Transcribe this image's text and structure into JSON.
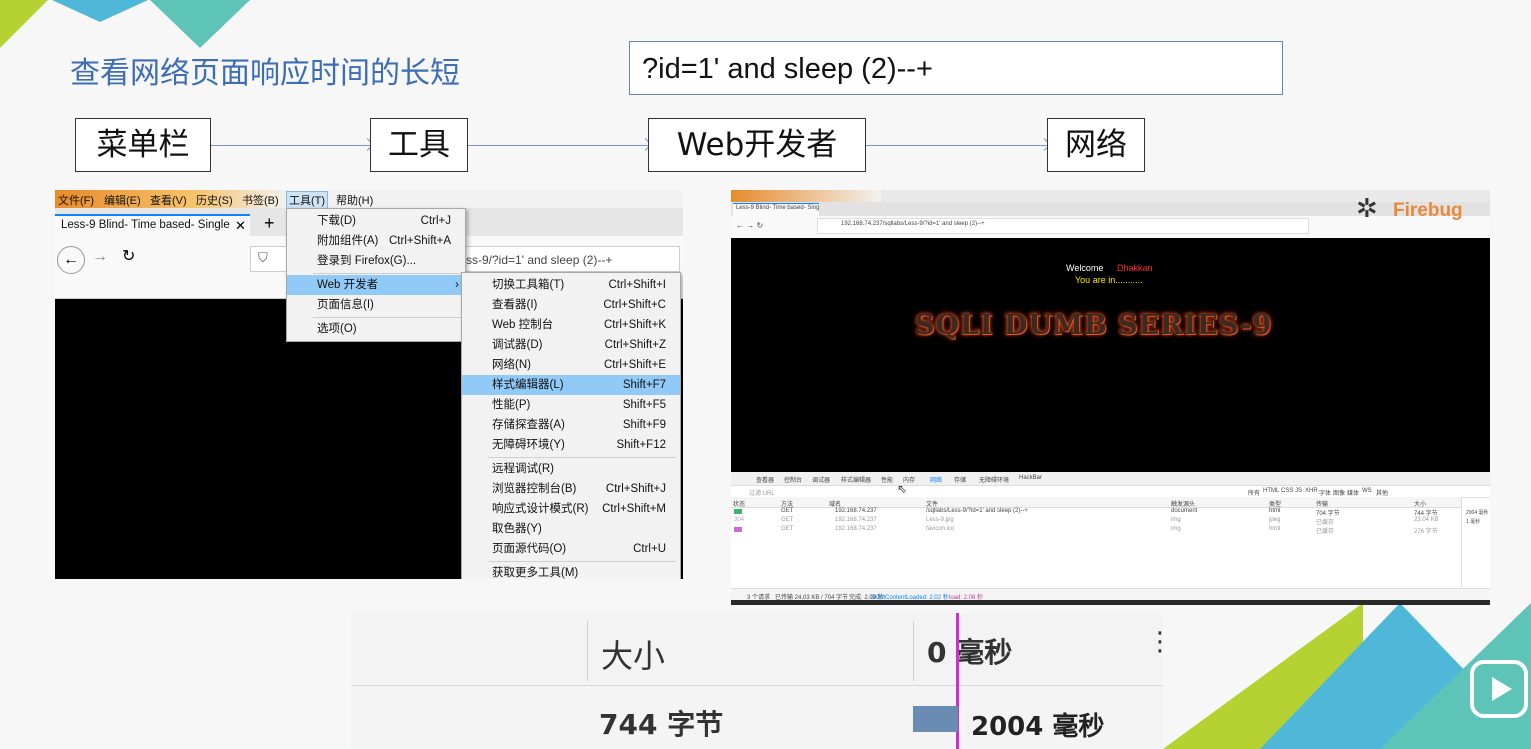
{
  "slide": {
    "title": "查看网络页面响应时间的长短",
    "sql_payload": "?id=1' and sleep (2)--+",
    "steps": [
      "菜单栏",
      "工具",
      "Web开发者",
      "网络"
    ]
  },
  "firefox_left": {
    "menubar": [
      "文件(F)",
      "编辑(E)",
      "查看(V)",
      "历史(S)",
      "书签(B)",
      "工具(T)",
      "帮助(H)"
    ],
    "tab_title": "Less-9 Blind- Time based- Single",
    "url_fragment": "ss-9/?id=1' and sleep (2)--+",
    "tools_menu": [
      {
        "label": "下载(D)",
        "shortcut": "Ctrl+J"
      },
      {
        "label": "附加组件(A)",
        "shortcut": "Ctrl+Shift+A"
      },
      {
        "label": "登录到 Firefox(G)...",
        "shortcut": ""
      },
      {
        "label": "Web 开发者",
        "shortcut": ""
      },
      {
        "label": "页面信息(I)",
        "shortcut": ""
      },
      {
        "label": "选项(O)",
        "shortcut": ""
      }
    ],
    "dev_menu": [
      {
        "label": "切换工具箱(T)",
        "shortcut": "Ctrl+Shift+I"
      },
      {
        "label": "查看器(I)",
        "shortcut": "Ctrl+Shift+C"
      },
      {
        "label": "Web 控制台",
        "shortcut": "Ctrl+Shift+K"
      },
      {
        "label": "调试器(D)",
        "shortcut": "Ctrl+Shift+Z"
      },
      {
        "label": "网络(N)",
        "shortcut": "Ctrl+Shift+E"
      },
      {
        "label": "样式编辑器(L)",
        "shortcut": "Shift+F7"
      },
      {
        "label": "性能(P)",
        "shortcut": "Shift+F5"
      },
      {
        "label": "存储探查器(A)",
        "shortcut": "Shift+F9"
      },
      {
        "label": "无障碍环境(Y)",
        "shortcut": "Shift+F12"
      },
      {
        "label": "远程调试(R)",
        "shortcut": ""
      },
      {
        "label": "浏览器控制台(B)",
        "shortcut": "Ctrl+Shift+J"
      },
      {
        "label": "响应式设计模式(R)",
        "shortcut": "Ctrl+Shift+M"
      },
      {
        "label": "取色器(Y)",
        "shortcut": ""
      },
      {
        "label": "页面源代码(O)",
        "shortcut": "Ctrl+U"
      },
      {
        "label": "获取更多工具(M)",
        "shortcut": ""
      }
    ]
  },
  "firefox_right": {
    "tab_title": "Less-9 Blind- Time based- Sing",
    "url": "192.168.74.237/sqllabs/Less-9/?id=1' and sleep (2)--+",
    "brand": "Firebug",
    "welcome": "Welcome",
    "user": "Dhakkan",
    "you_are_in": "You are in...........",
    "banner": "SQLI DUMB SERIES-9",
    "devtools_tabs": [
      "查看器",
      "控制台",
      "调试器",
      "样式编辑器",
      "性能",
      "内存",
      "网络",
      "存储",
      "无障碍环境",
      "HackBar"
    ],
    "filter_placeholder": "过滤 URL",
    "filter_types": [
      "所有",
      "HTML",
      "CSS",
      "JS",
      "XHR",
      "字体",
      "图像",
      "媒体",
      "WS",
      "其他"
    ],
    "columns": [
      "状态",
      "方法",
      "域名",
      "文件",
      "触发源头",
      "类型",
      "传输",
      "大小"
    ],
    "rows": [
      [
        "200",
        "GET",
        "192.168.74.237",
        "/sqllabs/Less-9/?id=1' and sleep (2)--+",
        "document",
        "html",
        "704 字节",
        "744 字节"
      ],
      [
        "304",
        "GET",
        "192.168.74.237",
        "Less-9.jpg",
        "img",
        "jpeg",
        "已缓存",
        "23.04 KB"
      ],
      [
        "304",
        "GET",
        "192.168.74.237",
        "favicon.ico",
        "img",
        "html",
        "已缓存",
        "276 字节"
      ]
    ],
    "timeline": [
      "2004 毫秒",
      "1 毫秒"
    ],
    "status_bar": [
      "3 个请求",
      "已传输 24.03 KB / 704 字节",
      "完成: 2.09 秒",
      "DOMContentLoaded: 2.02 秒",
      "load: 2.06 秒"
    ]
  },
  "zoom_panel": {
    "size_header": "大小",
    "time_header": "0 毫秒",
    "size_value": "744 字节",
    "time_value": "2004 毫秒"
  },
  "colors": {
    "title_blue": "#3d6db5",
    "menu_highlight": "#91c9f7",
    "deco_green": "#b6d232",
    "deco_blue": "#4fb8d9",
    "deco_teal": "#5fc4b8"
  }
}
